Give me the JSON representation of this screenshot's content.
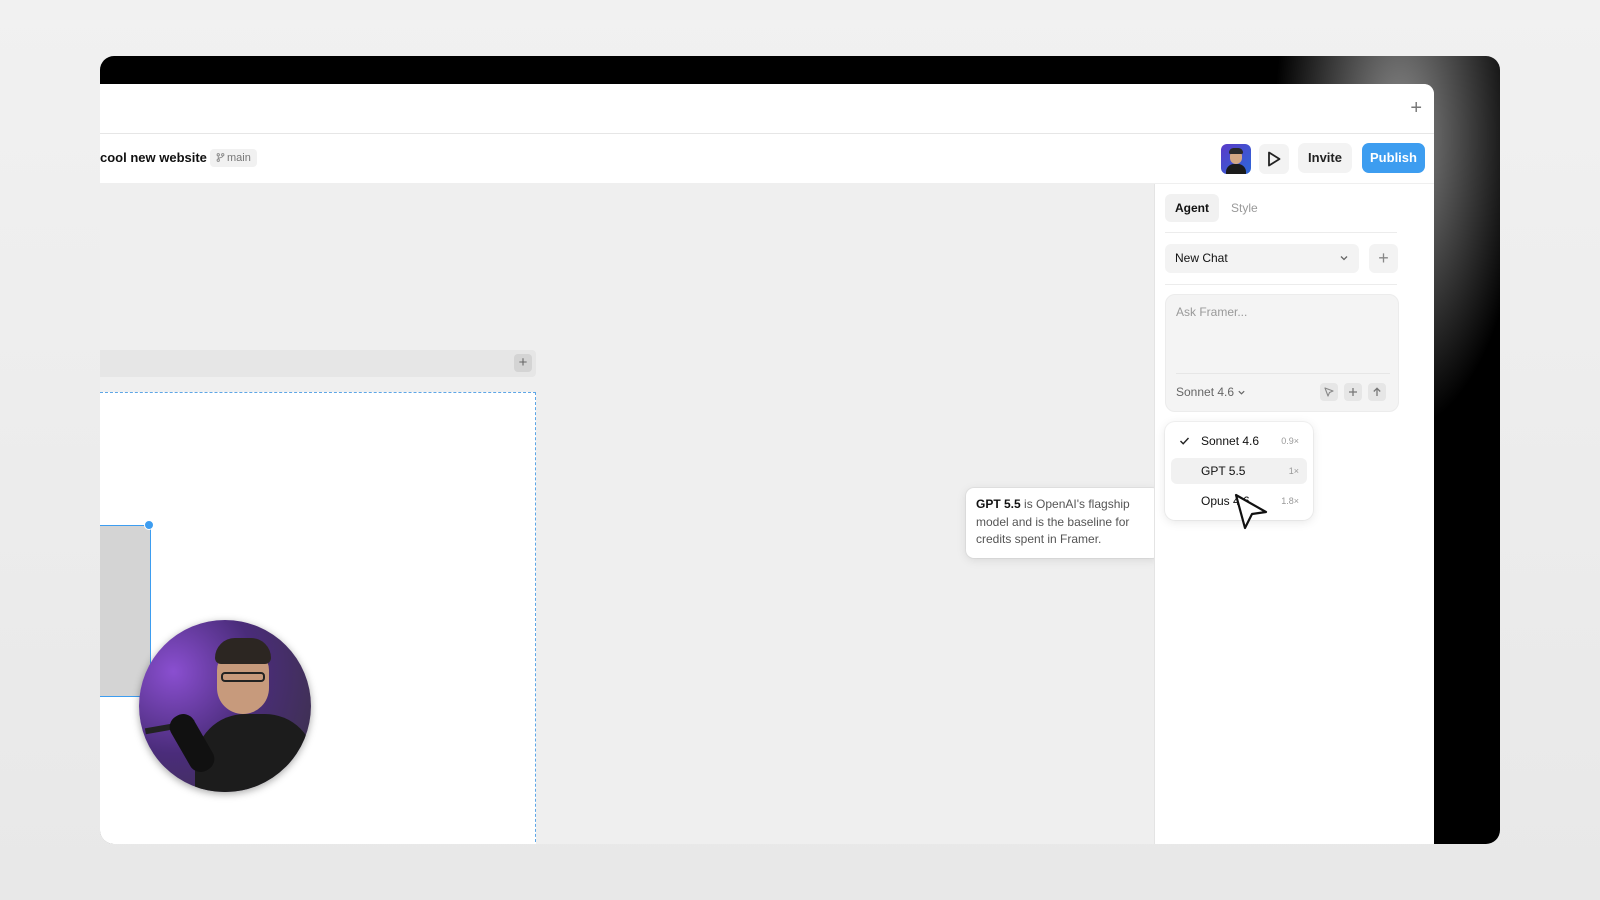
{
  "toolbar": {
    "project_title": "cool new website",
    "separator": "·",
    "branch": "main",
    "invite_label": "Invite",
    "publish_label": "Publish"
  },
  "tabbar": {
    "add_label": "+"
  },
  "canvas": {
    "layer_add_label": "+"
  },
  "panel": {
    "tabs": [
      {
        "label": "Agent",
        "active": true
      },
      {
        "label": "Style",
        "active": false
      }
    ],
    "chat_select": "New Chat",
    "new_chat_label": "+",
    "prompt_placeholder": "Ask Framer...",
    "model_selected": "Sonnet 4.6"
  },
  "model_menu": {
    "items": [
      {
        "name": "Sonnet 4.6",
        "multiplier": "0.9×",
        "checked": true
      },
      {
        "name": "GPT 5.5",
        "multiplier": "1×",
        "hovered": true
      },
      {
        "name": "Opus 4.6",
        "multiplier": "1.8×"
      }
    ]
  },
  "tooltip": {
    "bold": "GPT 5.5",
    "text": " is OpenAI's flagship model and is the baseline for credits spent in Framer."
  },
  "colors": {
    "accent": "#3d9df0",
    "canvas_bg": "#efefef",
    "frame_bg": "#000000"
  }
}
